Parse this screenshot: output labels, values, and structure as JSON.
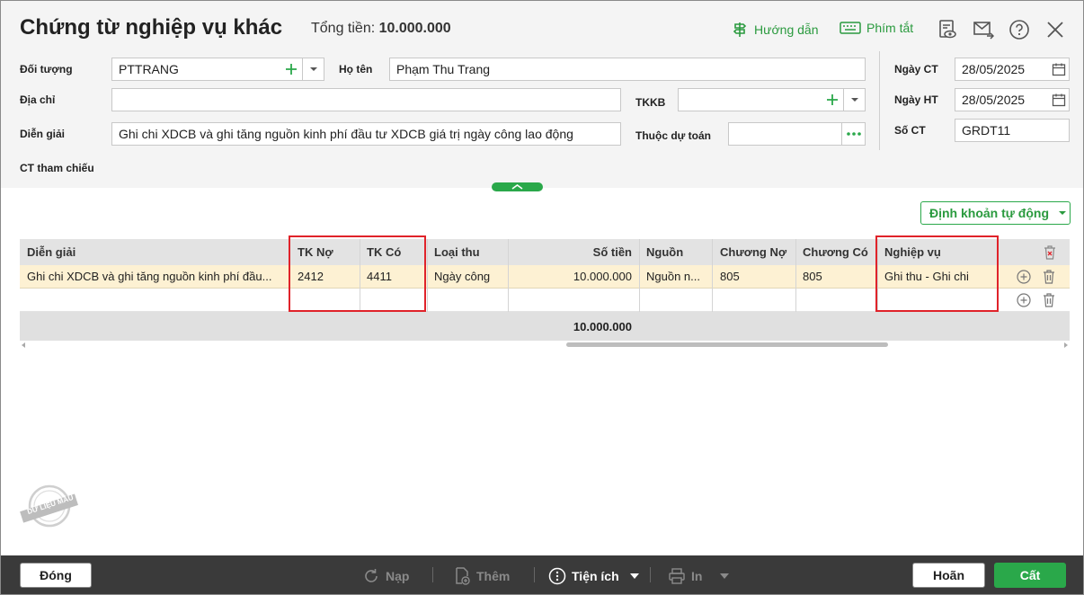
{
  "window": {
    "title": "Chứng từ nghiệp vụ khác",
    "total_label": "Tổng tiền:",
    "total_value": "10.000.000",
    "guide_label": "Hướng dẫn",
    "shortcut_label": "Phím tắt"
  },
  "form": {
    "object_label": "Đối tượng",
    "object_value": "PTTRANG",
    "name_label": "Họ tên",
    "name_value": "Phạm Thu Trang",
    "address_label": "Địa chỉ",
    "address_value": "",
    "tkkb_label": "TKKB",
    "tkkb_value": "",
    "desc_label": "Diễn giải",
    "desc_value": "Ghi chi XDCB và ghi tăng nguồn kinh phí đầu tư XDCB giá trị ngày công lao động",
    "budget_label": "Thuộc dự toán",
    "budget_value": "",
    "ref_label": "CT tham chiếu",
    "doc_date_label": "Ngày CT",
    "doc_date_value": "28/05/2025",
    "post_date_label": "Ngày HT",
    "post_date_value": "28/05/2025",
    "doc_no_label": "Số CT",
    "doc_no_value": "GRDT11"
  },
  "auto_post_label": "Định khoản tự động",
  "grid": {
    "headers": {
      "desc": "Diễn giải",
      "debit": "TK Nợ",
      "credit": "TK Có",
      "income_type": "Loại thu",
      "amount": "Số tiền",
      "source": "Nguồn",
      "debit_chapter": "Chương Nợ",
      "credit_chapter": "Chương Có",
      "operation": "Nghiệp vụ"
    },
    "row": {
      "desc": "Ghi chi XDCB và ghi tăng nguồn kinh phí đầu...",
      "debit": "2412",
      "credit": "4411",
      "income_type": "Ngày công",
      "amount": "10.000.000",
      "source": "Nguồn n...",
      "debit_chapter": "805",
      "credit_chapter": "805",
      "operation": "Ghi thu - Ghi chi"
    },
    "total": "10.000.000"
  },
  "watermark": "DỮ LIỆU MẪU",
  "footer": {
    "close": "Đóng",
    "reload": "Nạp",
    "add": "Thêm",
    "utilities": "Tiện ích",
    "print": "In",
    "cancel": "Hoãn",
    "save": "Cất"
  },
  "colors": {
    "accent": "#2aa84a",
    "highlight_border": "#e0232a",
    "selected_row": "#fdf1d3",
    "footer_bg": "#3a3a3a"
  }
}
